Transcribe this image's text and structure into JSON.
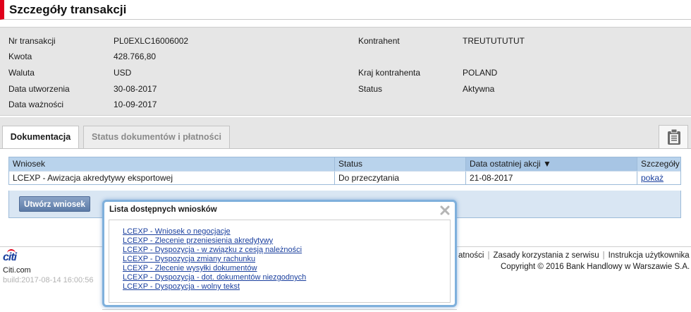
{
  "page": {
    "title": "Szczegóły transakcji"
  },
  "details": {
    "nr_transakcji": {
      "label": "Nr transakcji",
      "value": "PL0EXLC16006002"
    },
    "kwota": {
      "label": "Kwota",
      "value": "428.766,80"
    },
    "waluta": {
      "label": "Waluta",
      "value": "USD"
    },
    "data_utworzenia": {
      "label": "Data utworzenia",
      "value": "30-08-2017"
    },
    "data_waznosci": {
      "label": "Data ważności",
      "value": "10-09-2017"
    },
    "kontrahent": {
      "label": "Kontrahent",
      "value": "TREUTUTUTUT"
    },
    "kraj_kontrahenta": {
      "label": "Kraj kontrahenta",
      "value": "POLAND"
    },
    "status": {
      "label": "Status",
      "value": "Aktywna"
    }
  },
  "tabs": [
    {
      "label": "Dokumentacja",
      "active": true
    },
    {
      "label": "Status dokumentów i płatności",
      "active": false
    }
  ],
  "table": {
    "columns": [
      "Wniosek",
      "Status",
      "Data ostatniej akcji ▼",
      "Szczegóły"
    ],
    "rows": [
      {
        "wniosek": "LCEXP - Awizacja akredytywy eksportowej",
        "status": "Do przeczytania",
        "data": "21-08-2017",
        "link": "pokaż"
      }
    ]
  },
  "create_button": {
    "label": "Utwórz wniosek"
  },
  "popup": {
    "title": "Lista dostępnych wniosków",
    "items": [
      "LCEXP - Wniosek o negocjacje",
      "LCEXP - Zlecenie przeniesienia akredytywy",
      "LCEXP - Dyspozycja - w związku z cesją należności",
      "LCEXP - Dyspozycja zmiany rachunku",
      "LCEXP - Zlecenie wysyłki dokumentów",
      "LCEXP - Dyspozycja - dot. dokumentów niezgodnych",
      "LCEXP - Dyspozycja - wolny tekst"
    ]
  },
  "footer": {
    "logo": "citi",
    "site": "Citi.com",
    "build": "build:2017-08-14 16:00:56",
    "links": [
      "atności",
      "Zasady korzystania z serwisu",
      "Instrukcja użytkownika"
    ],
    "copyright": "Copyright © 2016 Bank Handlowy w Warszawie S.A."
  },
  "colors": {
    "accent": "#e0001b",
    "header_blue": "#b9d3ec",
    "link": "#1a3f9e",
    "popup_border": "#7fb0dc"
  },
  "icons": {
    "clipboard": "clipboard-icon",
    "close": "close-icon"
  }
}
